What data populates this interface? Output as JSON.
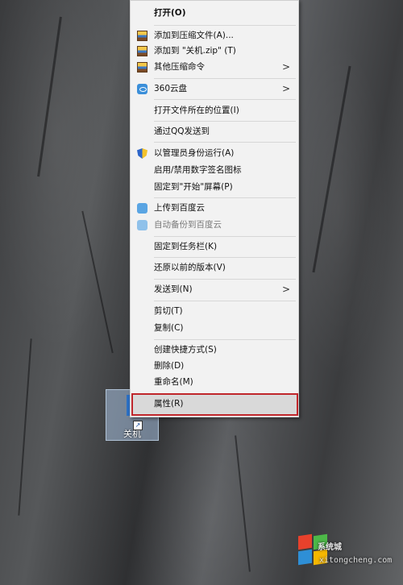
{
  "desktop": {
    "icon": {
      "label": "关机",
      "icon": "shutdown-shortcut-icon"
    }
  },
  "menu": {
    "items": [
      {
        "label": "打开(O)",
        "bold": true
      },
      {
        "label": "添加到压缩文件(A)...",
        "icon": "winrar-icon"
      },
      {
        "label": "添加到 \"关机.zip\" (T)",
        "icon": "winrar-icon"
      },
      {
        "label": "其他压缩命令",
        "icon": "winrar-icon",
        "submenu": true
      },
      {
        "label": "360云盘",
        "icon": "360-cloud-icon",
        "submenu": true
      },
      {
        "label": "打开文件所在的位置(I)"
      },
      {
        "label": "通过QQ发送到"
      },
      {
        "label": "以管理员身份运行(A)",
        "icon": "uac-shield-icon"
      },
      {
        "label": "启用/禁用数字签名图标"
      },
      {
        "label": "固定到\"开始\"屏幕(P)"
      },
      {
        "label": "上传到百度云",
        "icon": "baidu-cloud-icon"
      },
      {
        "label": "自动备份到百度云",
        "icon": "baidu-cloud-icon",
        "disabled": true
      },
      {
        "label": "固定到任务栏(K)"
      },
      {
        "label": "还原以前的版本(V)"
      },
      {
        "label": "发送到(N)",
        "submenu": true
      },
      {
        "label": "剪切(T)"
      },
      {
        "label": "复制(C)"
      },
      {
        "label": "创建快捷方式(S)"
      },
      {
        "label": "删除(D)"
      },
      {
        "label": "重命名(M)"
      },
      {
        "label": "属性(R)",
        "highlighted": true
      }
    ],
    "submenu_arrow": ">"
  },
  "watermark": {
    "text": "系统城",
    "site": "xitongcheng.com",
    "colors": {
      "red": "#e8412c",
      "green": "#4db848",
      "blue": "#2e8fd6",
      "yellow": "#f5b700"
    }
  }
}
